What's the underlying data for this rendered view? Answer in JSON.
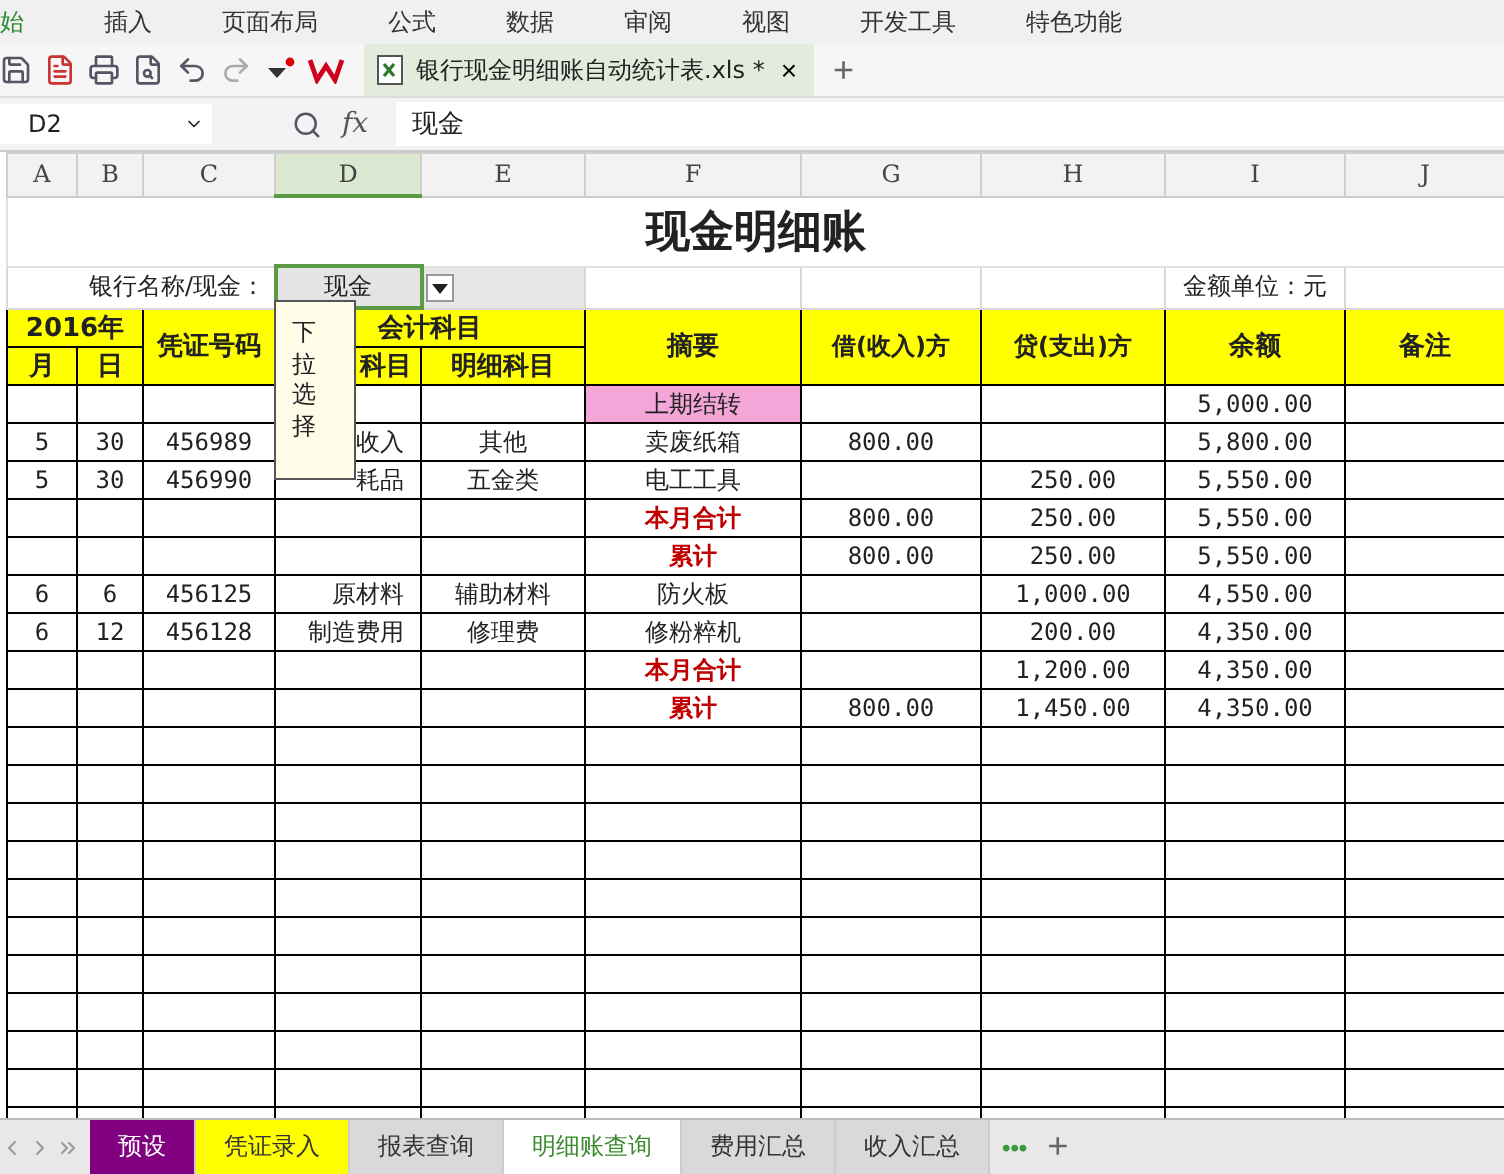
{
  "menu_bar": {
    "items": [
      {
        "label": "始",
        "selected": true
      },
      {
        "label": "插入",
        "selected": false
      },
      {
        "label": "页面布局",
        "selected": false
      },
      {
        "label": "公式",
        "selected": false
      },
      {
        "label": "数据",
        "selected": false
      },
      {
        "label": "审阅",
        "selected": false
      },
      {
        "label": "视图",
        "selected": false
      },
      {
        "label": "开发工具",
        "selected": false
      },
      {
        "label": "特色功能",
        "selected": false
      }
    ]
  },
  "toolbar": {
    "document_tab": {
      "title": "银行现金明细账自动统计表.xls *",
      "close": "×"
    },
    "new_tab": "+"
  },
  "formula_bar": {
    "cell_ref": "D2",
    "fx": "fx",
    "value": "现金"
  },
  "column_headers": [
    {
      "label": "A",
      "selected": false
    },
    {
      "label": "B",
      "selected": false
    },
    {
      "label": "C",
      "selected": false
    },
    {
      "label": "D",
      "selected": true
    },
    {
      "label": "E",
      "selected": false
    },
    {
      "label": "F",
      "selected": false
    },
    {
      "label": "G",
      "selected": false
    },
    {
      "label": "H",
      "selected": false
    },
    {
      "label": "I",
      "selected": false
    },
    {
      "label": "J",
      "selected": false
    }
  ],
  "sheet": {
    "title": "现金明细账",
    "bank_label": "银行名称/现金：",
    "bank_value": "现金",
    "unit_label": "金额单位：元",
    "header": {
      "year": "2016年",
      "month": "月",
      "day": "日",
      "voucher": "凭证号码",
      "account": "会计科目",
      "account_partial": "科目",
      "detail": "明细科目",
      "summary": "摘要",
      "debit": "借(收入)方",
      "credit": "贷(支出)方",
      "balance": "余额",
      "note": "备注"
    },
    "dropdown_hint": "下拉选择",
    "rows": [
      {
        "kind": "carryover",
        "summary": "上期结转",
        "balance": "5,000.00"
      },
      {
        "kind": "entry",
        "month": "5",
        "day": "30",
        "voucher": "456989",
        "account": "收入",
        "detail": "其他",
        "summary": "卖废纸箱",
        "debit": "800.00",
        "balance": "5,800.00"
      },
      {
        "kind": "entry",
        "month": "5",
        "day": "30",
        "voucher": "456990",
        "account": "耗品",
        "detail": "五金类",
        "summary": "电工工具",
        "credit": "250.00",
        "balance": "5,550.00"
      },
      {
        "kind": "total",
        "summary": "本月合计",
        "debit": "800.00",
        "credit": "250.00",
        "balance": "5,550.00"
      },
      {
        "kind": "total",
        "summary": "累计",
        "debit": "800.00",
        "credit": "250.00",
        "balance": "5,550.00"
      },
      {
        "kind": "entry",
        "month": "6",
        "day": "6",
        "voucher": "456125",
        "account": "原材料",
        "detail": "辅助材料",
        "summary": "防火板",
        "credit": "1,000.00",
        "balance": "4,550.00"
      },
      {
        "kind": "entry",
        "month": "6",
        "day": "12",
        "voucher": "456128",
        "account": "制造费用",
        "detail": "修理费",
        "summary": "修粉粹机",
        "credit": "200.00",
        "balance": "4,350.00"
      },
      {
        "kind": "total",
        "summary": "本月合计",
        "credit": "1,200.00",
        "balance": "4,350.00"
      },
      {
        "kind": "total",
        "summary": "累计",
        "debit": "800.00",
        "credit": "1,450.00",
        "balance": "4,350.00"
      }
    ]
  },
  "sheet_tabs": {
    "tabs": [
      {
        "label": "预设",
        "selected": false,
        "color": "#800080"
      },
      {
        "label": "凭证录入",
        "selected": false,
        "color": "#ffff00"
      },
      {
        "label": "报表查询",
        "selected": false,
        "color": "#d9d9d9"
      },
      {
        "label": "明细账查询",
        "selected": true
      },
      {
        "label": "费用汇总",
        "selected": false,
        "color": "#d9d9d9"
      },
      {
        "label": "收入汇总",
        "selected": false,
        "color": "#d9d9d9"
      }
    ],
    "more": "•••",
    "add": "+"
  }
}
